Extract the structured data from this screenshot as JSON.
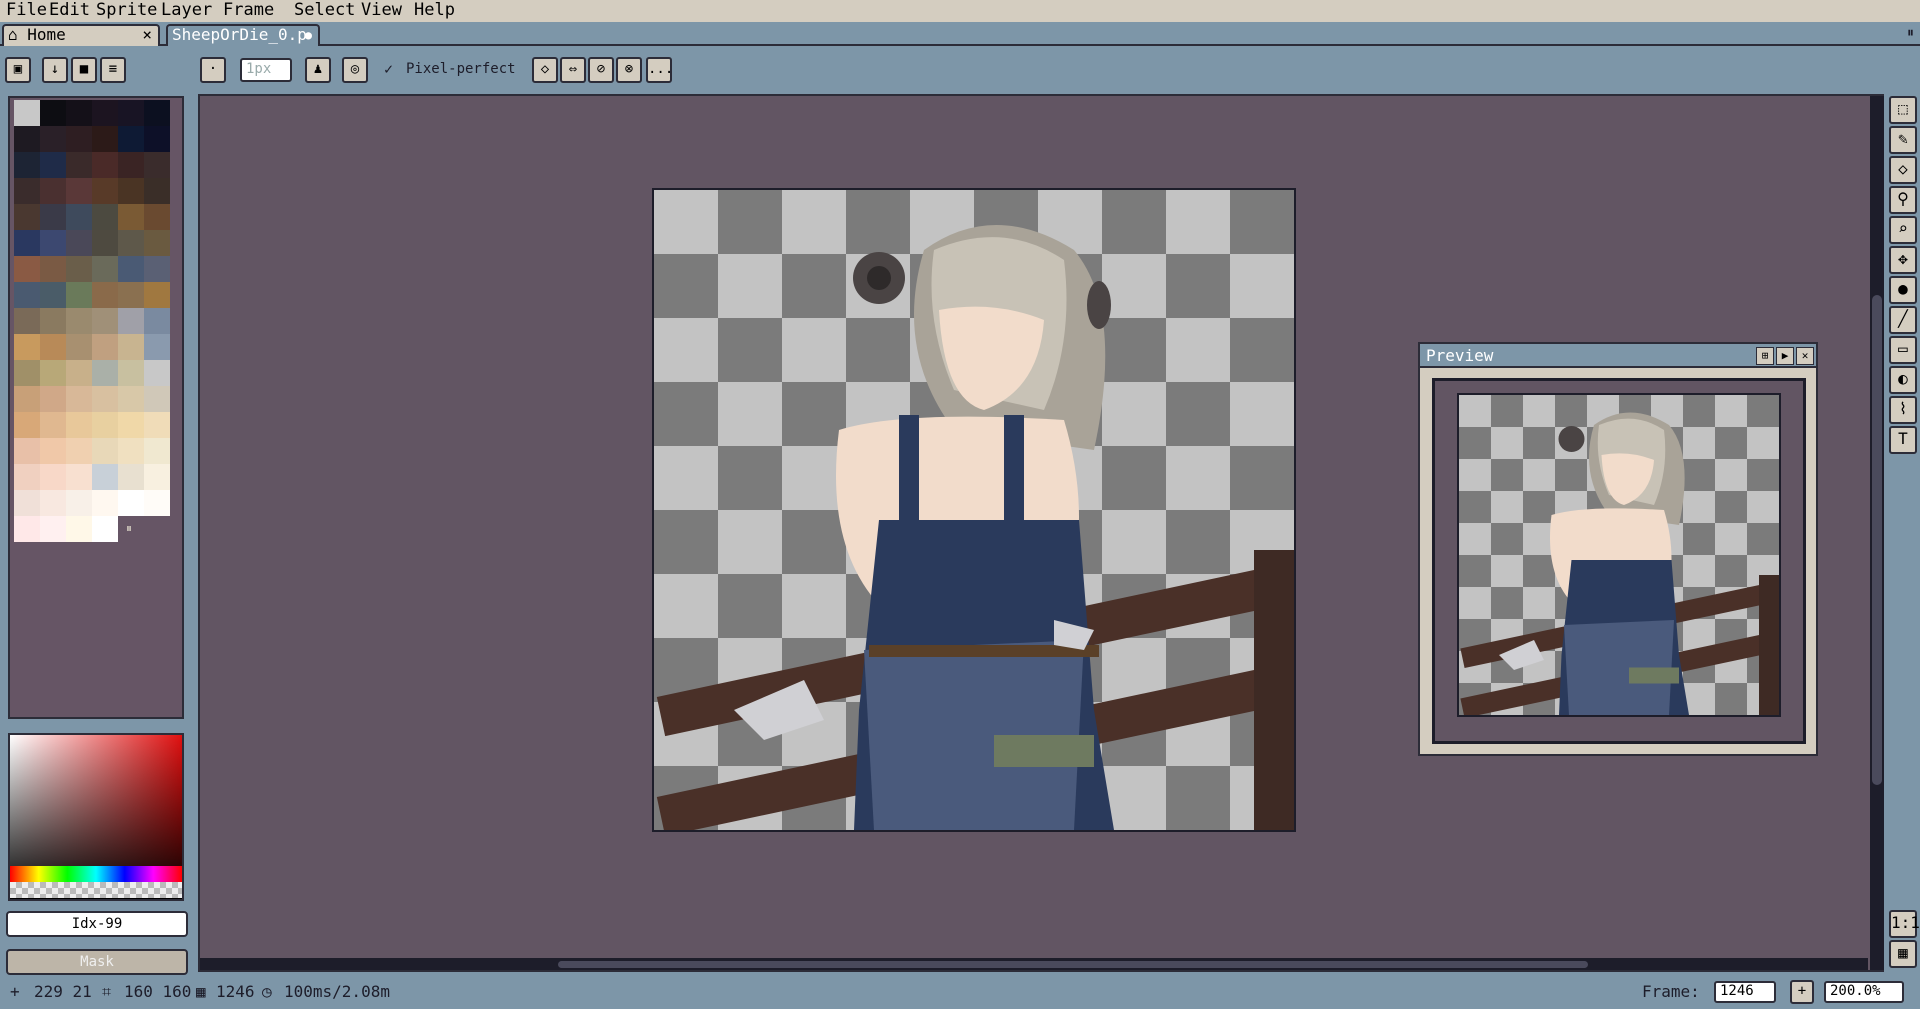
{
  "menu": [
    "File",
    "Edit",
    "Sprite",
    "Layer",
    "Frame",
    "Select",
    "View",
    "Help"
  ],
  "tabs": [
    {
      "label": "Home",
      "close": "×"
    },
    {
      "label": "SheepOrDie_0.p",
      "indicator": "●"
    }
  ],
  "toolbar": {
    "brush_size_placeholder": "1px",
    "pixel_perfect_label": "Pixel-perfect",
    "more_label": "..."
  },
  "palette": {
    "colors": [
      "#c8c8c8",
      "#0d0d12",
      "#141018",
      "#1c1420",
      "#181424",
      "#0c1020",
      "#1e1a22",
      "#2a2028",
      "#2e1e22",
      "#2c1a18",
      "#0e1a34",
      "#0d1028",
      "#1d2434",
      "#1f2b48",
      "#3a2a2a",
      "#4a2a28",
      "#3a2424",
      "#3a2c2c",
      "#3a2c2c",
      "#4a3030",
      "#5a3838",
      "#583a28",
      "#4a3424",
      "#3a2e28",
      "#4a3830",
      "#3a3a48",
      "#3e4a5c",
      "#4c4a40",
      "#7a5a34",
      "#6a4a30",
      "#2a3860",
      "#3c4870",
      "#4a4858",
      "#4e4a40",
      "#5e584a",
      "#6a5a40",
      "#8a5a44",
      "#7a5a44",
      "#6a5e4a",
      "#6a6a5a",
      "#4a5a74",
      "#5a6074",
      "#4a5a70",
      "#4a5c68",
      "#6a7a5a",
      "#8a6a4a",
      "#8a7050",
      "#a07840",
      "#7a6a58",
      "#8a7a60",
      "#9a8a6e",
      "#a09078",
      "#a0a0a8",
      "#7a8aa0",
      "#c89a5e",
      "#b88a58",
      "#a89070",
      "#c0a080",
      "#c8b490",
      "#8a9aae",
      "#a09068",
      "#b8a878",
      "#c8b08a",
      "#aab0a8",
      "#c8c0a0",
      "#c8c8c8",
      "#c8a078",
      "#d0a888",
      "#d8b898",
      "#d8c0a0",
      "#d8c8a8",
      "#d0c8b8",
      "#d8a878",
      "#e0b890",
      "#e8c89a",
      "#e8d0a0",
      "#f0d8a8",
      "#f0dcb8",
      "#e8c0a8",
      "#f0c8a8",
      "#f0d0b0",
      "#e8d8b8",
      "#f0e0c0",
      "#f0e8d0",
      "#f0d0c0",
      "#f8d8c8",
      "#f8e0d0",
      "#c8d0d8",
      "#e8e0d0",
      "#f8f0e0",
      "#f0e0d8",
      "#f8e8e0",
      "#f8f0e8",
      "#fff8f0",
      "#ffffff",
      "#fffcf8",
      "#ffe8e8",
      "#fff0f0",
      "#fff8e8",
      "#ffffff"
    ]
  },
  "color_index_label": "Idx-99",
  "mask_label": "Mask",
  "preview": {
    "title": "Preview"
  },
  "status": {
    "cursor_pos": "229 21",
    "sprite_size": "160 160",
    "frame_count": "1246",
    "duration": "100ms/2.08m",
    "frame_label": "Frame:",
    "frame_value": "1246",
    "add_label": "+",
    "zoom_value": "200.0%"
  },
  "tools": [
    "marquee-tool",
    "pencil-tool",
    "eraser-tool",
    "eyedropper-tool",
    "zoom-tool",
    "move-tool",
    "fill-tool",
    "line-tool",
    "rectangle-tool",
    "blob-tool",
    "blur-tool",
    "text-tool"
  ],
  "colors": {
    "ui_bg": "#7d96a8",
    "canvas_bg": "#625563",
    "panel_light": "#d4cdc0",
    "outline": "#2c2c38"
  }
}
